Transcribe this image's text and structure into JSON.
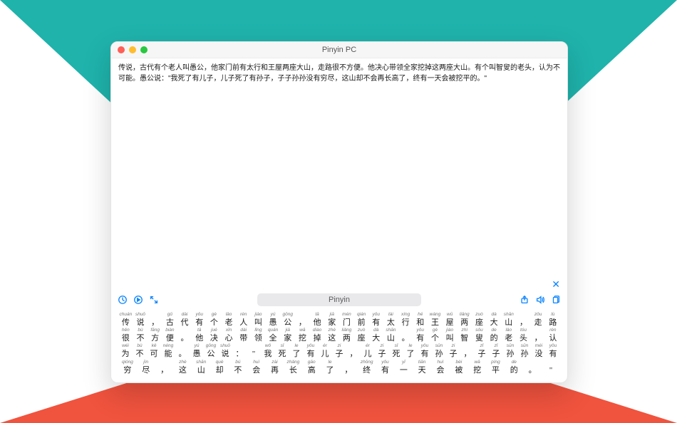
{
  "window": {
    "title": "Pinyin PC"
  },
  "text": "传说，古代有个老人叫愚公，他家门前有太行和王屋两座大山，走路很不方便。他决心带领全家挖掉这两座大山。有个叫智叟的老头，认为不可能。愚公说：\"我死了有儿子，儿子死了有孙子，子子孙孙没有穷尽，这山却不会再长高了，终有一天会被挖平的。\"",
  "toolbar": {
    "mode_label": "Pinyin"
  },
  "chart_data": {
    "type": "table",
    "title": "Pinyin-annotated text",
    "rows": [
      [
        {
          "py": "chuán",
          "hz": "传"
        },
        {
          "py": "shuō",
          "hz": "说"
        },
        {
          "py": "",
          "hz": "，"
        },
        {
          "py": "gǔ",
          "hz": "古"
        },
        {
          "py": "dài",
          "hz": "代"
        },
        {
          "py": "yǒu",
          "hz": "有"
        },
        {
          "py": "gè",
          "hz": "个"
        },
        {
          "py": "lǎo",
          "hz": "老"
        },
        {
          "py": "rén",
          "hz": "人"
        },
        {
          "py": "jiào",
          "hz": "叫"
        },
        {
          "py": "yú",
          "hz": "愚"
        },
        {
          "py": "gōng",
          "hz": "公"
        },
        {
          "py": "",
          "hz": "，"
        },
        {
          "py": "tā",
          "hz": "他"
        },
        {
          "py": "jiā",
          "hz": "家"
        },
        {
          "py": "mén",
          "hz": "门"
        },
        {
          "py": "qián",
          "hz": "前"
        },
        {
          "py": "yǒu",
          "hz": "有"
        },
        {
          "py": "tài",
          "hz": "太"
        },
        {
          "py": "xíng",
          "hz": "行"
        },
        {
          "py": "hé",
          "hz": "和"
        },
        {
          "py": "wáng",
          "hz": "王"
        },
        {
          "py": "wū",
          "hz": "屋"
        },
        {
          "py": "liǎng",
          "hz": "两"
        },
        {
          "py": "zuò",
          "hz": "座"
        },
        {
          "py": "dà",
          "hz": "大"
        },
        {
          "py": "shān",
          "hz": "山"
        },
        {
          "py": "",
          "hz": "，"
        },
        {
          "py": "zǒu",
          "hz": "走"
        },
        {
          "py": "lù",
          "hz": "路"
        }
      ],
      [
        {
          "py": "hěn",
          "hz": "很"
        },
        {
          "py": "bù",
          "hz": "不"
        },
        {
          "py": "fāng",
          "hz": "方"
        },
        {
          "py": "biàn",
          "hz": "便"
        },
        {
          "py": "",
          "hz": "。"
        },
        {
          "py": "tā",
          "hz": "他"
        },
        {
          "py": "jué",
          "hz": "决"
        },
        {
          "py": "xīn",
          "hz": "心"
        },
        {
          "py": "dài",
          "hz": "带"
        },
        {
          "py": "lǐng",
          "hz": "领"
        },
        {
          "py": "quán",
          "hz": "全"
        },
        {
          "py": "jiā",
          "hz": "家"
        },
        {
          "py": "wā",
          "hz": "挖"
        },
        {
          "py": "diào",
          "hz": "掉"
        },
        {
          "py": "zhè",
          "hz": "这"
        },
        {
          "py": "liǎng",
          "hz": "两"
        },
        {
          "py": "zuò",
          "hz": "座"
        },
        {
          "py": "dà",
          "hz": "大"
        },
        {
          "py": "shān",
          "hz": "山"
        },
        {
          "py": "",
          "hz": "。"
        },
        {
          "py": "yǒu",
          "hz": "有"
        },
        {
          "py": "gè",
          "hz": "个"
        },
        {
          "py": "jiào",
          "hz": "叫"
        },
        {
          "py": "zhì",
          "hz": "智"
        },
        {
          "py": "sǒu",
          "hz": "叟"
        },
        {
          "py": "de",
          "hz": "的"
        },
        {
          "py": "lǎo",
          "hz": "老"
        },
        {
          "py": "tóu",
          "hz": "头"
        },
        {
          "py": "",
          "hz": "，"
        },
        {
          "py": "rèn",
          "hz": "认"
        }
      ],
      [
        {
          "py": "wéi",
          "hz": "为"
        },
        {
          "py": "bù",
          "hz": "不"
        },
        {
          "py": "kě",
          "hz": "可"
        },
        {
          "py": "néng",
          "hz": "能"
        },
        {
          "py": "",
          "hz": "。"
        },
        {
          "py": "yú",
          "hz": "愚"
        },
        {
          "py": "gōng",
          "hz": "公"
        },
        {
          "py": "shuō",
          "hz": "说"
        },
        {
          "py": "",
          "hz": "："
        },
        {
          "py": "",
          "hz": "\""
        },
        {
          "py": "wǒ",
          "hz": "我"
        },
        {
          "py": "sǐ",
          "hz": "死"
        },
        {
          "py": "le",
          "hz": "了"
        },
        {
          "py": "yǒu",
          "hz": "有"
        },
        {
          "py": "ér",
          "hz": "儿"
        },
        {
          "py": "zi",
          "hz": "子"
        },
        {
          "py": "",
          "hz": "，"
        },
        {
          "py": "ér",
          "hz": "儿"
        },
        {
          "py": "zi",
          "hz": "子"
        },
        {
          "py": "sǐ",
          "hz": "死"
        },
        {
          "py": "le",
          "hz": "了"
        },
        {
          "py": "yǒu",
          "hz": "有"
        },
        {
          "py": "sūn",
          "hz": "孙"
        },
        {
          "py": "zi",
          "hz": "子"
        },
        {
          "py": "",
          "hz": "，"
        },
        {
          "py": "zǐ",
          "hz": "子"
        },
        {
          "py": "zǐ",
          "hz": "子"
        },
        {
          "py": "sūn",
          "hz": "孙"
        },
        {
          "py": "sūn",
          "hz": "孙"
        },
        {
          "py": "méi",
          "hz": "没"
        },
        {
          "py": "yǒu",
          "hz": "有"
        }
      ],
      [
        {
          "py": "qióng",
          "hz": "穷"
        },
        {
          "py": "jìn",
          "hz": "尽"
        },
        {
          "py": "",
          "hz": "，"
        },
        {
          "py": "zhè",
          "hz": "这"
        },
        {
          "py": "shān",
          "hz": "山"
        },
        {
          "py": "què",
          "hz": "却"
        },
        {
          "py": "bú",
          "hz": "不"
        },
        {
          "py": "huì",
          "hz": "会"
        },
        {
          "py": "zài",
          "hz": "再"
        },
        {
          "py": "zhǎng",
          "hz": "长"
        },
        {
          "py": "gāo",
          "hz": "高"
        },
        {
          "py": "le",
          "hz": "了"
        },
        {
          "py": "",
          "hz": "，"
        },
        {
          "py": "zhōng",
          "hz": "终"
        },
        {
          "py": "yǒu",
          "hz": "有"
        },
        {
          "py": "yī",
          "hz": "一"
        },
        {
          "py": "tiān",
          "hz": "天"
        },
        {
          "py": "huì",
          "hz": "会"
        },
        {
          "py": "bèi",
          "hz": "被"
        },
        {
          "py": "wā",
          "hz": "挖"
        },
        {
          "py": "píng",
          "hz": "平"
        },
        {
          "py": "de",
          "hz": "的"
        },
        {
          "py": "",
          "hz": "。"
        },
        {
          "py": "",
          "hz": "\""
        }
      ]
    ]
  }
}
